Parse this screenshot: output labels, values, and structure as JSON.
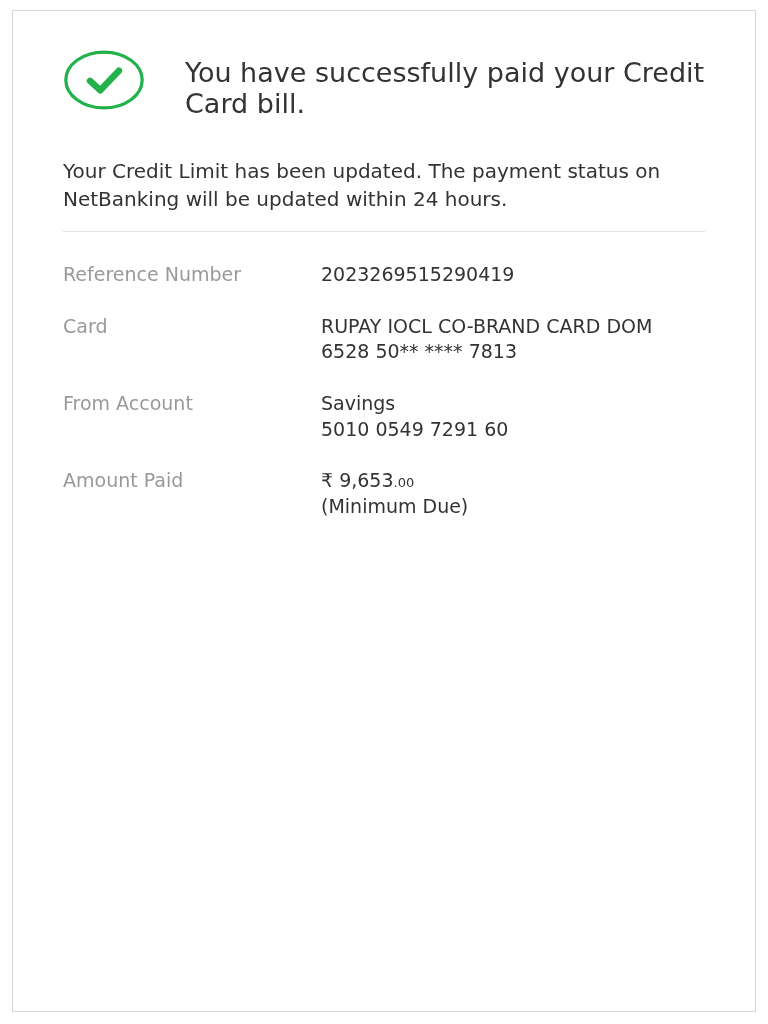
{
  "header": {
    "success": true,
    "title": "You have successfully paid your Credit Card bill."
  },
  "message": "Your Credit Limit has been updated. The payment status on NetBanking will be updated within 24 hours.",
  "details": [
    {
      "label": "Reference Number",
      "lines": [
        "2023269515290419"
      ]
    },
    {
      "label": "Card",
      "lines": [
        "RUPAY IOCL CO-BRAND CARD DOM",
        "6528 50** **** 7813"
      ]
    },
    {
      "label": "From Account",
      "lines": [
        "Savings",
        "5010 0549 7291 60"
      ]
    }
  ],
  "amount": {
    "label": "Amount Paid",
    "value": "₹ 9,653",
    "decimals": ".00",
    "note": "(Minimum Due)"
  }
}
